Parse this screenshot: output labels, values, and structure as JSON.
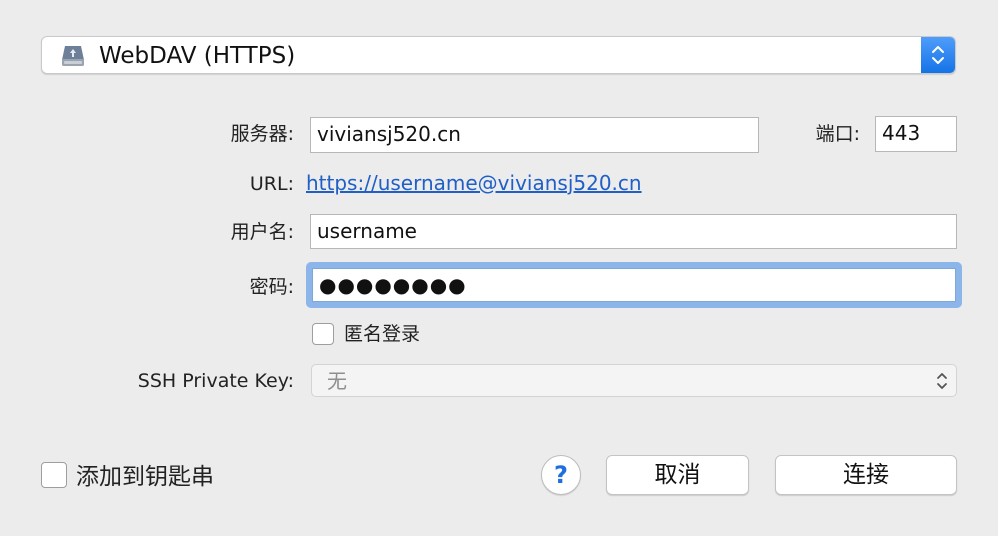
{
  "protocol": {
    "selected": "WebDAV (HTTPS)",
    "icon": "network-drive-icon"
  },
  "server": {
    "label": "服务器:",
    "value": "viviansj520.cn"
  },
  "port": {
    "label": "端口:",
    "value": "443"
  },
  "url": {
    "label": "URL:",
    "value": "https://username@viviansj520.cn"
  },
  "username": {
    "label": "用户名:",
    "value": "username"
  },
  "password": {
    "label": "密码:",
    "value": "●●●●●●●●"
  },
  "anonymous": {
    "label": "匿名登录",
    "checked": false
  },
  "ssh_key": {
    "label": "SSH Private Key:",
    "value": "无"
  },
  "keychain": {
    "label": "添加到钥匙串",
    "checked": false
  },
  "buttons": {
    "help": "?",
    "cancel": "取消",
    "connect": "连接"
  },
  "colors": {
    "accent": "#1473e6",
    "link": "#1f5fc6",
    "focus_ring": "#8cb6ea"
  }
}
